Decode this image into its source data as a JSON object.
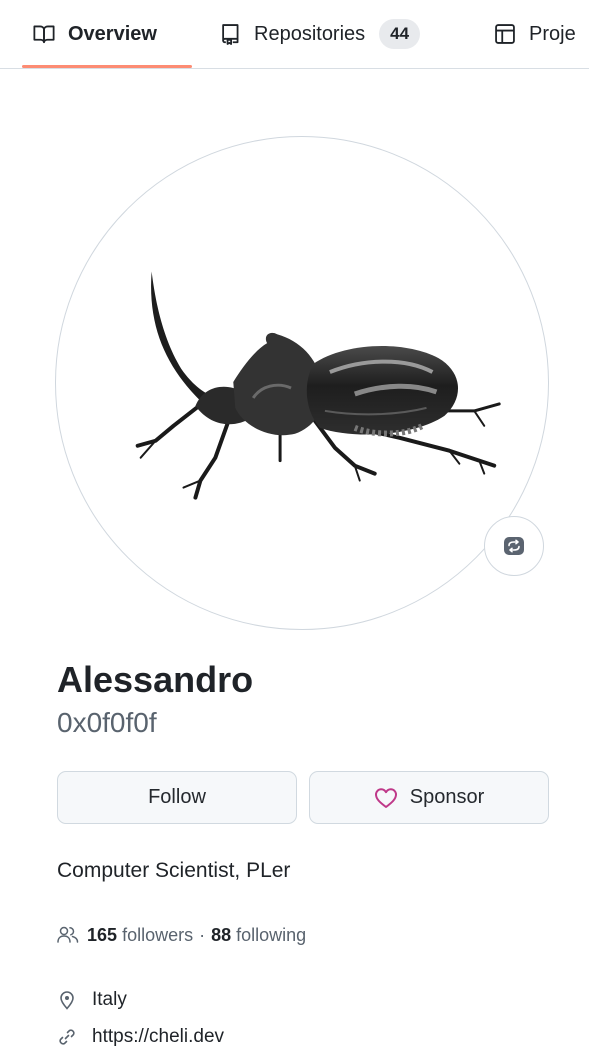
{
  "tabs": {
    "overview_label": "Overview",
    "repositories_label": "Repositories",
    "repositories_count": "44",
    "projects_label": "Proje"
  },
  "profile": {
    "full_name": "Alessandro",
    "username": "0x0f0f0f",
    "avatar_icon": "rhinoceros-beetle-illustration",
    "edit_avatar_icon": "change-avatar-icon"
  },
  "actions": {
    "follow_label": "Follow",
    "sponsor_label": "Sponsor",
    "sponsor_icon_color": "#bf3989"
  },
  "bio": "Computer Scientist, PLer",
  "social": {
    "followers_count": "165",
    "followers_label": "followers",
    "separator": "·",
    "following_count": "88",
    "following_label": "following"
  },
  "details": {
    "location": "Italy",
    "website": "https://cheli.dev"
  },
  "colors": {
    "active_tab_underline": "#fd8c73",
    "muted_text": "#59636e"
  }
}
